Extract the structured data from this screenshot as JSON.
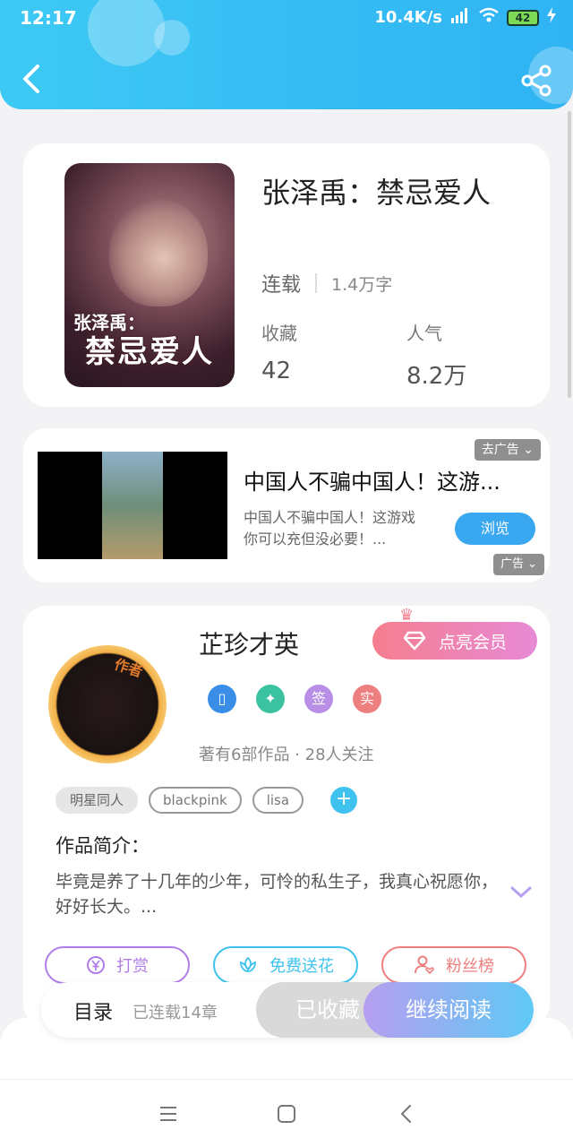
{
  "status_bar": {
    "time": "12:17",
    "network_speed": "10.4K/s",
    "battery": "42"
  },
  "book": {
    "title": "张泽禹：禁忌爱人",
    "cover_title": "禁忌爱人",
    "cover_subtitle": "张泽禹：",
    "status": "连载",
    "word_count": "1.4万字",
    "favorites_label": "收藏",
    "favorites_value": "42",
    "popularity_label": "人气",
    "popularity_value": "8.2万"
  },
  "ad": {
    "title": "中国人不骗中国人！这游...",
    "description": "中国人不骗中国人！这游戏你可以充但没必要！...",
    "browse_label": "浏览",
    "remove_ad_label": "去广告",
    "ad_label": "广告"
  },
  "author": {
    "avatar_badge": "作者",
    "name": "芷珍才英",
    "vip_label": "点亮会员",
    "badges": [
      "",
      "",
      "签",
      "实"
    ],
    "meta": "著有6部作品 · 28人关注",
    "tags": [
      "明星同人",
      "blackpink",
      "lisa"
    ],
    "intro_label": "作品简介：",
    "intro_text": "毕竟是养了十几年的少年，可怜的私生子，我真心祝愿你，好好长大。...",
    "actions": {
      "tip": "打赏",
      "flowers": "免费送花",
      "fans": "粉丝榜"
    }
  },
  "bottom_bar": {
    "toc": "目录",
    "chapters": "已连载14章",
    "collected": "已收藏",
    "continue": "继续阅读"
  },
  "colors": {
    "header": "#2fb3f3",
    "accent_blue": "#3aa8f0",
    "vip_pink": "#f57e8e",
    "tip_purple": "#b07ee6",
    "flower_cyan": "#3fc3ee",
    "fans_red": "#ee7f7f"
  }
}
